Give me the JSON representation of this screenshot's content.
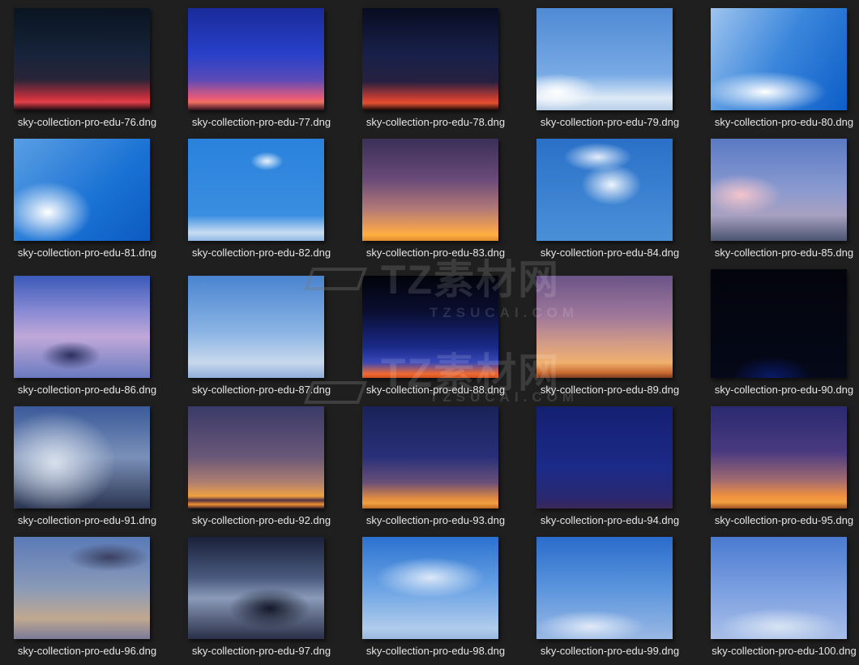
{
  "files": [
    {
      "name": "sky-collection-pro-edu-76.dng",
      "bg": "linear-gradient(#0a1420 0%,#16233a 45%,#2a2438 70%,#c8303c 88%,#e0404a 92%,#1a0a10 100%)"
    },
    {
      "name": "sky-collection-pro-edu-77.dng",
      "bg": "linear-gradient(#1a2a9a 0%,#2740c8 45%,#5a4ab8 70%,#e85a78 88%,#f07060 92%,#301020 100%)"
    },
    {
      "name": "sky-collection-pro-edu-78.dng",
      "bg": "linear-gradient(#080c20 0%,#18204a 45%,#262040 72%,#d84030 90%,#e05030 93%,#1a0808 100%)"
    },
    {
      "name": "sky-collection-pro-edu-79.dng",
      "bg": "radial-gradient(ellipse 30% 18% at 15% 82%,#fff 0%,rgba(255,255,255,0) 100%),linear-gradient(#4f8ad4 0%,#78aae4 65%,#dde9f6 88%,#b8cfe8 100%)"
    },
    {
      "name": "sky-collection-pro-edu-80.dng",
      "bg": "radial-gradient(ellipse 45% 20% at 40% 82%,#fff 0%,rgba(255,255,255,0) 100%),linear-gradient(120deg,#9ec4ee 0%,#3a86dc 50%,#0c5ec8 100%)"
    },
    {
      "name": "sky-collection-pro-edu-81.dng",
      "bg": "radial-gradient(ellipse 32% 30% at 25% 72%,#fff 0%,rgba(255,255,255,0) 100%),linear-gradient(135deg,#5a9ee4 0%,#1a72d4 60%,#0c5ac0 100%)"
    },
    {
      "name": "sky-collection-pro-edu-82.dng",
      "bg": "radial-gradient(ellipse 12% 9% at 58% 22%,#e8f2fc 0%,rgba(255,255,255,0) 100%),linear-gradient(#2a82dc 0%,#3a8ee0 75%,#c8dcf2 92%,#90b8e4 100%)"
    },
    {
      "name": "sky-collection-pro-edu-83.dng",
      "bg": "linear-gradient(#3a3058 0%,#6a4a78 40%,#b07878 68%,#f0a050 88%,#ffb040 94%,#e08a30 100%)"
    },
    {
      "name": "sky-collection-pro-edu-84.dng",
      "bg": "radial-gradient(ellipse 22% 20% at 55% 45%,#eef4fc 0%,rgba(255,255,255,0) 100%),radial-gradient(ellipse 25% 14% at 45% 18%,#e0ecfa 0%,rgba(255,255,255,0) 100%),linear-gradient(#2a70c8,#4a90d8)"
    },
    {
      "name": "sky-collection-pro-edu-85.dng",
      "bg": "radial-gradient(ellipse 30% 20% at 22% 55%,#f4c4cc 0%,rgba(255,255,255,0) 100%),linear-gradient(#5a7ac4 0%,#8a9ad0 50%,#a8a0c0 75%,#4a5470 100%)"
    },
    {
      "name": "sky-collection-pro-edu-86.dng",
      "bg": "radial-gradient(ellipse 22% 14% at 42% 78%,#2a3060 0%,rgba(40,50,100,0) 100%),linear-gradient(#3a5ab8 0%,#8a8ad4 35%,#c0a8d8 60%,#6a7ac0 100%)"
    },
    {
      "name": "sky-collection-pro-edu-87.dng",
      "bg": "linear-gradient(#4a84d0 0%,#8ab4e4 55%,#c8d8ec 85%,#90aedc 100%)"
    },
    {
      "name": "sky-collection-pro-edu-88.dng",
      "bg": "linear-gradient(#02030a 0%,#0a0e30 35%,#1a2a8a 70%,#3a48b8 85%,#f06a30 96%,#d05020 100%)"
    },
    {
      "name": "sky-collection-pro-edu-89.dng",
      "bg": "linear-gradient(#6a5488 0%,#a0789a 40%,#d09a88 65%,#f0b070 85%,#c86a30 95%,#7a3a20 100%)"
    },
    {
      "name": "sky-collection-pro-edu-90.dng",
      "bg": "radial-gradient(ellipse 30% 20% at 45% 100%,#0a1a6a 0%,rgba(0,0,0,0) 100%),linear-gradient(#03040c,#050818)"
    },
    {
      "name": "sky-collection-pro-edu-91.dng",
      "bg": "radial-gradient(ellipse 45% 50% at 30% 55%,#d8e0ec 0%,rgba(200,210,230,0) 100%),linear-gradient(#3a5a9a 0%,#7a90b8 50%,#2a3450 100%)"
    },
    {
      "name": "sky-collection-pro-edu-92.dng",
      "bg": "linear-gradient(#3a3a68 0%,#6a5878 50%,#b08070 75%,#f0a040 88%,#503040 92%,#f09030 96%,#3a2028 100%)"
    },
    {
      "name": "sky-collection-pro-edu-93.dng",
      "bg": "linear-gradient(#1a2258 0%,#2a3078 50%,#6a5078 75%,#e08a40 90%,#f0a040 95%,#c06a20 100%)"
    },
    {
      "name": "sky-collection-pro-edu-94.dng",
      "bg": "linear-gradient(#142070 0%,#1c2a88 60%,#2a2870 90%,#3a2858 100%)"
    },
    {
      "name": "sky-collection-pro-edu-95.dng",
      "bg": "linear-gradient(#2a2a70 0%,#4a3a80 45%,#a06a70 72%,#f09040 88%,#f0a040 94%,#a05020 100%)"
    },
    {
      "name": "sky-collection-pro-edu-96.dng",
      "bg": "radial-gradient(ellipse 30% 14% at 70% 20%,#3a4060 0%,rgba(60,60,90,0) 100%),linear-gradient(#5a7ab8 0%,#8a9ab8 50%,#c0a890 80%,#7a7a98 100%)"
    },
    {
      "name": "sky-collection-pro-edu-97.dng",
      "bg": "radial-gradient(ellipse 30% 20% at 60% 70%,#14182a 0%,rgba(20,20,40,0) 100%),linear-gradient(#1a2038 0%,#4a5a80 40%,#8a9ab8 60%,#2a3048 100%)"
    },
    {
      "name": "sky-collection-pro-edu-98.dng",
      "bg": "radial-gradient(ellipse 40% 20% at 50% 40%,#dbe8f8 0%,rgba(255,255,255,0) 100%),linear-gradient(#2a72d0 0%,#6aa2e4 50%,#b0cceb 90%,#9ab8e0 100%)"
    },
    {
      "name": "sky-collection-pro-edu-99.dng",
      "bg": "radial-gradient(ellipse 40% 16% at 40% 88%,#e0eaf8 0%,rgba(255,255,255,0) 100%),linear-gradient(#2a6ccc 0%,#5a94dc 50%,#9ab8e4 100%)"
    },
    {
      "name": "sky-collection-pro-edu-100.dng",
      "bg": "radial-gradient(ellipse 45% 18% at 50% 88%,#d8e4f4 0%,rgba(255,255,255,0) 100%),linear-gradient(#4a7ad0 0%,#7a9ee0 50%,#a8bee8 100%)"
    }
  ],
  "watermark": {
    "brand": "TZ素材网",
    "domain": "TZSUCAI.COM"
  }
}
